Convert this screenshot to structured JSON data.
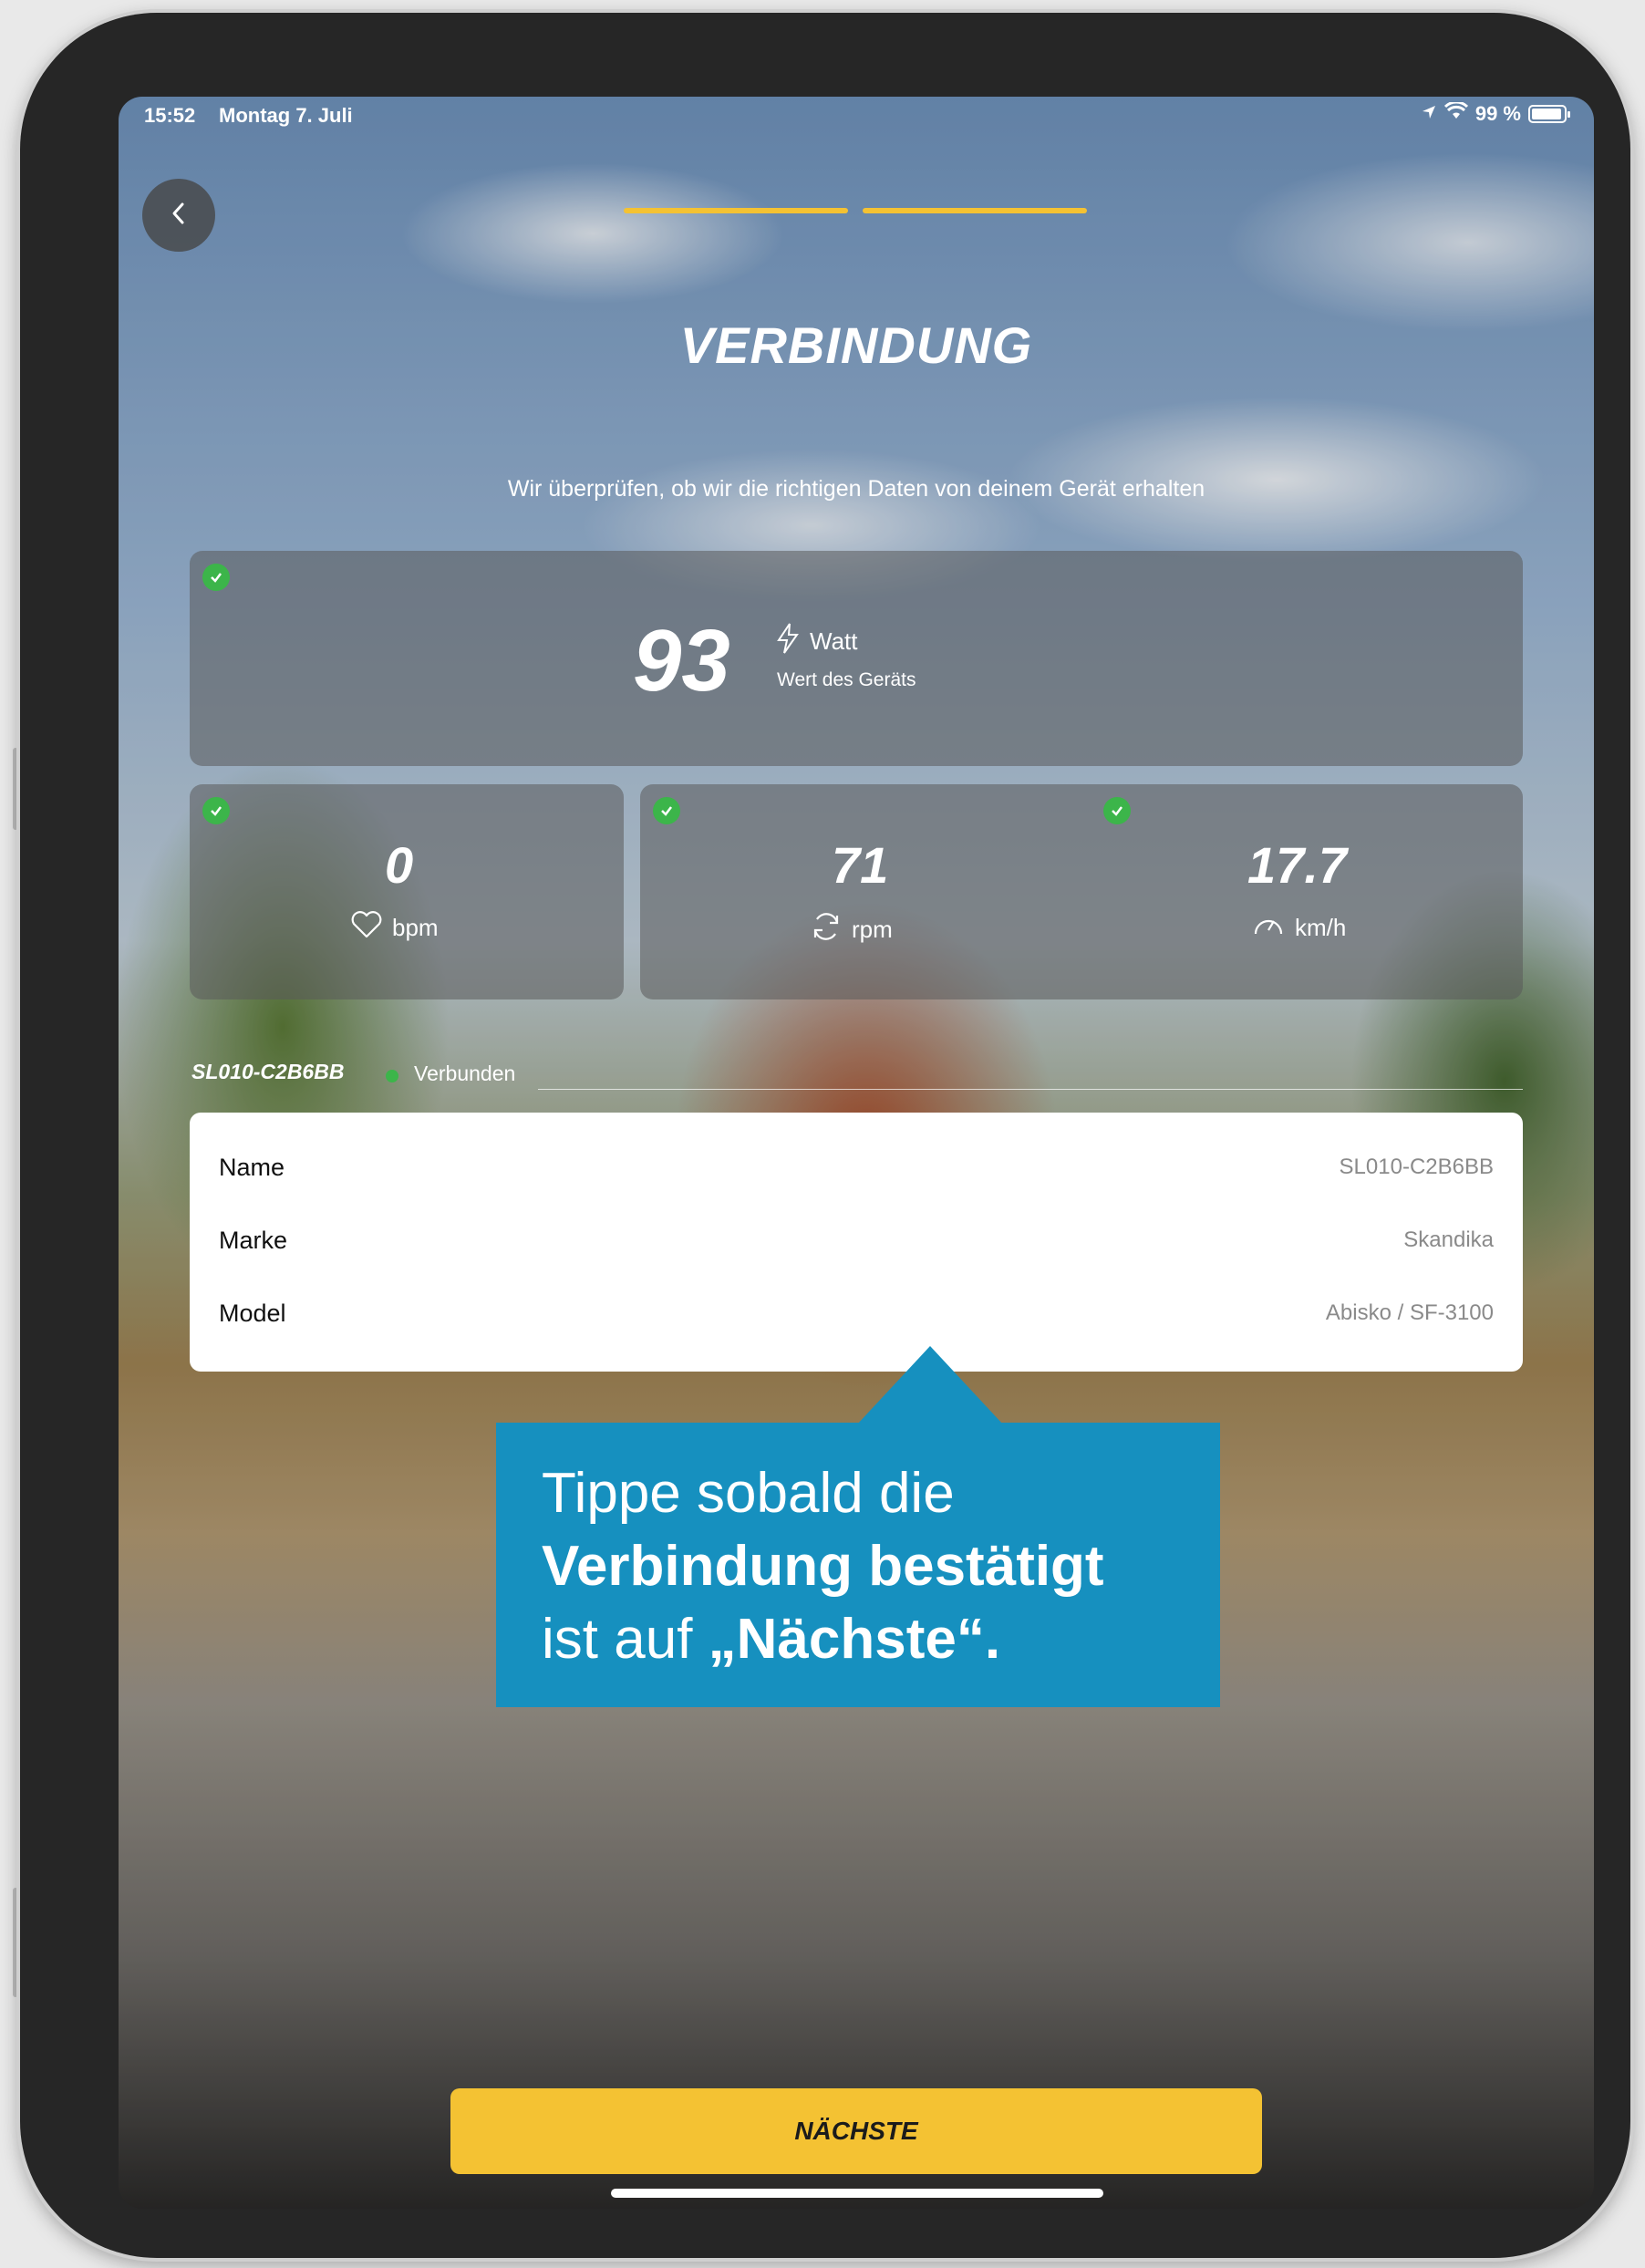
{
  "status_bar": {
    "time": "15:52",
    "date": "Montag 7. Juli",
    "battery": "99 %"
  },
  "header": {
    "title": "VERBINDUNG",
    "subtitle": "Wir überprüfen, ob wir die richtigen Daten von deinem Gerät erhalten"
  },
  "progress": {
    "steps_total": 2,
    "steps_done": 2,
    "color": "#f4c233"
  },
  "metrics": {
    "power": {
      "value": "93",
      "unit": "Watt",
      "caption": "Wert des Geräts",
      "icon": "lightning-icon"
    },
    "heart_rate": {
      "value": "0",
      "unit": "bpm",
      "icon": "heart-icon"
    },
    "cadence": {
      "value": "71",
      "unit": "rpm",
      "icon": "refresh-icon"
    },
    "speed": {
      "value": "17.7",
      "unit": "km/h",
      "icon": "speedometer-icon"
    }
  },
  "device": {
    "name": "SL010-C2B6BB",
    "status": "Verbunden",
    "status_color": "#3cb54a",
    "rows": [
      {
        "label": "Name",
        "value": "SL010-C2B6BB"
      },
      {
        "label": "Marke",
        "value": "Skandika"
      },
      {
        "label": "Model",
        "value": "Abisko / SF-3100"
      }
    ]
  },
  "tooltip": {
    "line1": "Tippe sobald die",
    "line2": "Verbindung bestätigt",
    "line3_prefix": "ist auf ",
    "line3_bold": "„Nächste“.",
    "color": "#1690bf"
  },
  "next_button": {
    "label": "NÄCHSTE",
    "color": "#f4c233"
  }
}
